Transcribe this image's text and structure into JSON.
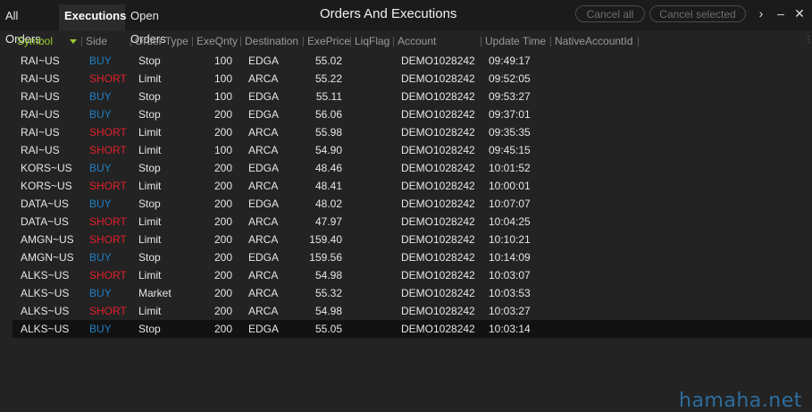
{
  "tabs": [
    {
      "label": "All Orders",
      "active": false
    },
    {
      "label": "Executions",
      "active": true
    },
    {
      "label": "Open Orders",
      "active": false
    }
  ],
  "window": {
    "title": "Orders And Executions",
    "cancel_all_label": "Cancel all",
    "cancel_selected_label": "Cancel selected",
    "more_icon": "chevron-right-icon",
    "minimize_icon": "minimize-icon",
    "close_icon": "close-icon"
  },
  "columns": {
    "symbol": "Symbol",
    "side": "Side",
    "order_type": "Order Type",
    "exe_qnty": "ExeQnty",
    "destination": "Destination",
    "exe_price": "ExePrice",
    "liq_flag": "LiqFlag",
    "account": "Account",
    "update_time": "Update Time",
    "native_account_id": "NativeAccountId"
  },
  "colors": {
    "buy": "#1f7fc4",
    "short": "#e0202a",
    "sorted_header": "#9acd32"
  },
  "rows": [
    {
      "symbol": "RAI~US",
      "side": "BUY",
      "order_type": "Stop",
      "exe_qnty": "100",
      "destination": "EDGA",
      "exe_price": "55.02",
      "liq_flag": "",
      "account": "DEMO1028242",
      "update_time": "09:49:17",
      "native_account_id": ""
    },
    {
      "symbol": "RAI~US",
      "side": "SHORT",
      "order_type": "Limit",
      "exe_qnty": "100",
      "destination": "ARCA",
      "exe_price": "55.22",
      "liq_flag": "",
      "account": "DEMO1028242",
      "update_time": "09:52:05",
      "native_account_id": ""
    },
    {
      "symbol": "RAI~US",
      "side": "BUY",
      "order_type": "Stop",
      "exe_qnty": "100",
      "destination": "EDGA",
      "exe_price": "55.11",
      "liq_flag": "",
      "account": "DEMO1028242",
      "update_time": "09:53:27",
      "native_account_id": ""
    },
    {
      "symbol": "RAI~US",
      "side": "BUY",
      "order_type": "Stop",
      "exe_qnty": "200",
      "destination": "EDGA",
      "exe_price": "56.06",
      "liq_flag": "",
      "account": "DEMO1028242",
      "update_time": "09:37:01",
      "native_account_id": ""
    },
    {
      "symbol": "RAI~US",
      "side": "SHORT",
      "order_type": "Limit",
      "exe_qnty": "200",
      "destination": "ARCA",
      "exe_price": "55.98",
      "liq_flag": "",
      "account": "DEMO1028242",
      "update_time": "09:35:35",
      "native_account_id": ""
    },
    {
      "symbol": "RAI~US",
      "side": "SHORT",
      "order_type": "Limit",
      "exe_qnty": "100",
      "destination": "ARCA",
      "exe_price": "54.90",
      "liq_flag": "",
      "account": "DEMO1028242",
      "update_time": "09:45:15",
      "native_account_id": ""
    },
    {
      "symbol": "KORS~US",
      "side": "BUY",
      "order_type": "Stop",
      "exe_qnty": "200",
      "destination": "EDGA",
      "exe_price": "48.46",
      "liq_flag": "",
      "account": "DEMO1028242",
      "update_time": "10:01:52",
      "native_account_id": ""
    },
    {
      "symbol": "KORS~US",
      "side": "SHORT",
      "order_type": "Limit",
      "exe_qnty": "200",
      "destination": "ARCA",
      "exe_price": "48.41",
      "liq_flag": "",
      "account": "DEMO1028242",
      "update_time": "10:00:01",
      "native_account_id": ""
    },
    {
      "symbol": "DATA~US",
      "side": "BUY",
      "order_type": "Stop",
      "exe_qnty": "200",
      "destination": "EDGA",
      "exe_price": "48.02",
      "liq_flag": "",
      "account": "DEMO1028242",
      "update_time": "10:07:07",
      "native_account_id": ""
    },
    {
      "symbol": "DATA~US",
      "side": "SHORT",
      "order_type": "Limit",
      "exe_qnty": "200",
      "destination": "ARCA",
      "exe_price": "47.97",
      "liq_flag": "",
      "account": "DEMO1028242",
      "update_time": "10:04:25",
      "native_account_id": ""
    },
    {
      "symbol": "AMGN~US",
      "side": "SHORT",
      "order_type": "Limit",
      "exe_qnty": "200",
      "destination": "ARCA",
      "exe_price": "159.40",
      "liq_flag": "",
      "account": "DEMO1028242",
      "update_time": "10:10:21",
      "native_account_id": ""
    },
    {
      "symbol": "AMGN~US",
      "side": "BUY",
      "order_type": "Stop",
      "exe_qnty": "200",
      "destination": "EDGA",
      "exe_price": "159.56",
      "liq_flag": "",
      "account": "DEMO1028242",
      "update_time": "10:14:09",
      "native_account_id": ""
    },
    {
      "symbol": "ALKS~US",
      "side": "SHORT",
      "order_type": "Limit",
      "exe_qnty": "200",
      "destination": "ARCA",
      "exe_price": "54.98",
      "liq_flag": "",
      "account": "DEMO1028242",
      "update_time": "10:03:07",
      "native_account_id": ""
    },
    {
      "symbol": "ALKS~US",
      "side": "BUY",
      "order_type": "Market",
      "exe_qnty": "200",
      "destination": "ARCA",
      "exe_price": "55.32",
      "liq_flag": "",
      "account": "DEMO1028242",
      "update_time": "10:03:53",
      "native_account_id": ""
    },
    {
      "symbol": "ALKS~US",
      "side": "SHORT",
      "order_type": "Limit",
      "exe_qnty": "200",
      "destination": "ARCA",
      "exe_price": "54.98",
      "liq_flag": "",
      "account": "DEMO1028242",
      "update_time": "10:03:27",
      "native_account_id": ""
    },
    {
      "symbol": "ALKS~US",
      "side": "BUY",
      "order_type": "Stop",
      "exe_qnty": "200",
      "destination": "EDGA",
      "exe_price": "55.05",
      "liq_flag": "",
      "account": "DEMO1028242",
      "update_time": "10:03:14",
      "native_account_id": "",
      "selected": true
    }
  ],
  "watermark": "hamaha.net"
}
